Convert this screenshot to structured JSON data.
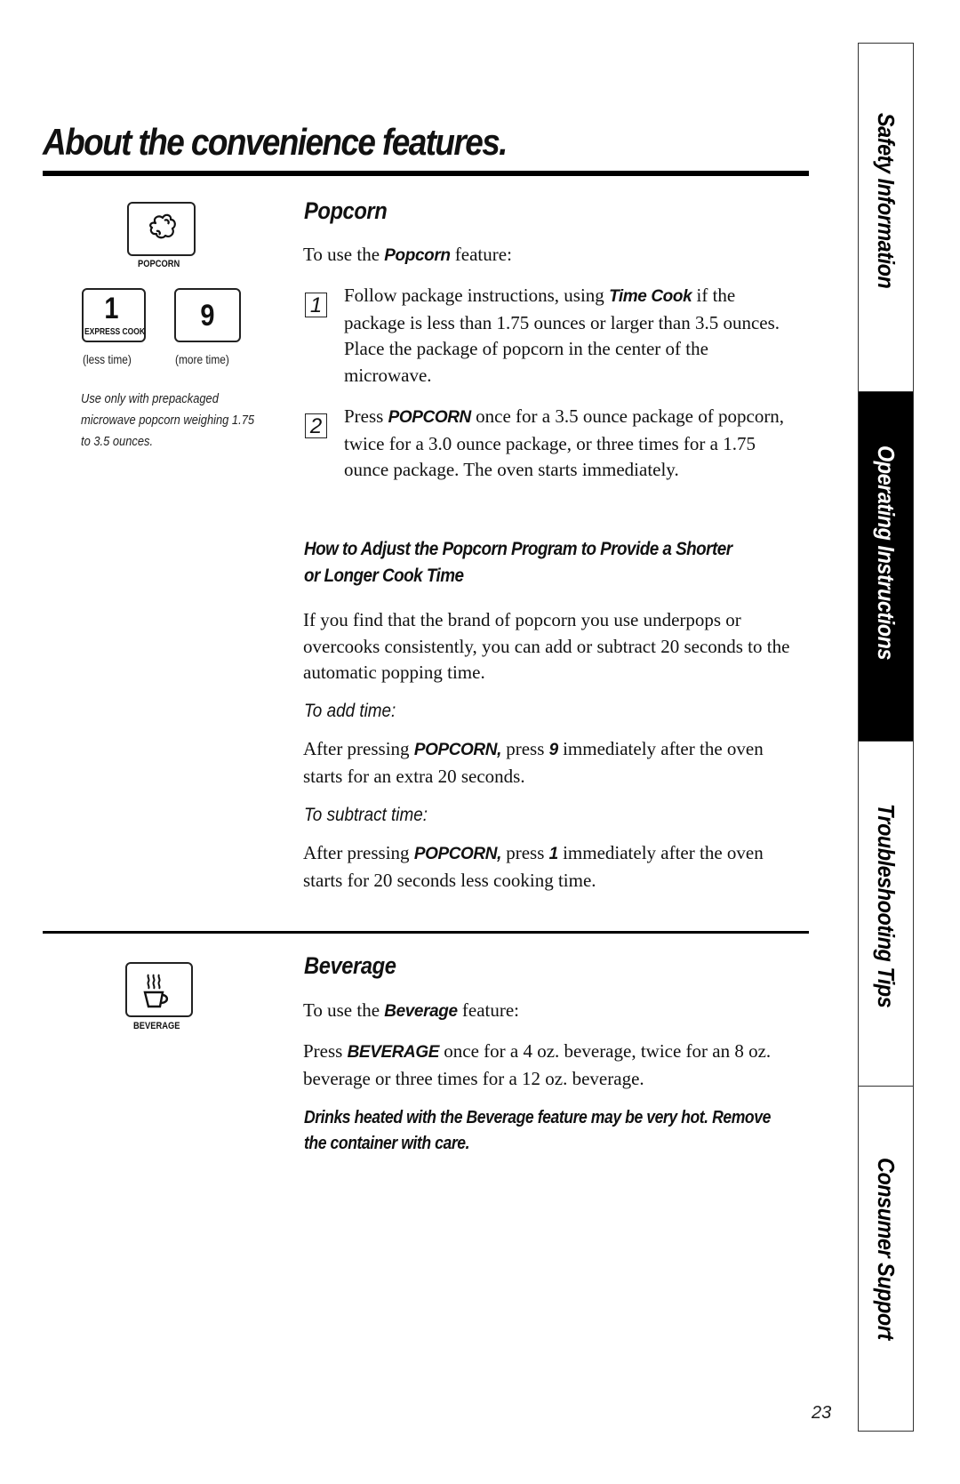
{
  "page": {
    "title": "About the convenience features.",
    "page_number": "23"
  },
  "side_tabs": [
    {
      "label": "Safety Information",
      "active": false
    },
    {
      "label": "Operating Instructions",
      "active": true
    },
    {
      "label": "Troubleshooting Tips",
      "active": false
    },
    {
      "label": "Consumer Support",
      "active": false
    }
  ],
  "popcorn": {
    "heading": "Popcorn",
    "icon": "popcorn-icon",
    "key_label": "POPCORN",
    "key_one": {
      "digit": "1",
      "label": "EXPRESS COOK",
      "caption": "(less time)"
    },
    "key_nine": {
      "digit": "9",
      "caption": "(more time)"
    },
    "note": "Use only with prepackaged microwave popcorn weighing 1.75 to 3.5 ounces.",
    "intro": {
      "before": "To use the ",
      "bold": "Popcorn",
      "after": " feature:"
    },
    "steps": [
      {
        "number": "1",
        "before": "Follow package instructions, using ",
        "bold": "Time Cook",
        "after": " if the package is less than 1.75 ounces or larger than 3.5 ounces. Place the package of popcorn in the center of the microwave."
      },
      {
        "number": "2",
        "before": "Press ",
        "bold": "POPCORN",
        "after": " once for a 3.5 ounce package of popcorn, twice for a 3.0 ounce package, or three times for a 1.75 ounce package. The oven starts immediately."
      }
    ],
    "adjust": {
      "heading": "How to Adjust the Popcorn Program to Provide a Shorter or Longer Cook Time",
      "body": "If you find that the brand of popcorn you use underpops or overcooks consistently, you can add or subtract 20 seconds to the automatic popping time.",
      "add": {
        "label": "To add time:",
        "before": "After pressing ",
        "bold1": "POPCORN,",
        "middle": " press ",
        "bold2": "9",
        "after": "  immediately after the oven starts for an extra 20 seconds."
      },
      "subtract": {
        "label": "To subtract time:",
        "before": "After pressing ",
        "bold1": "POPCORN,",
        "middle": " press ",
        "bold2": "1",
        "after": "  immediately after the oven starts for 20 seconds less cooking time."
      }
    }
  },
  "beverage": {
    "heading": "Beverage",
    "icon": "beverage-cup-icon",
    "key_label": "BEVERAGE",
    "intro": {
      "before": "To use the ",
      "bold": "Beverage",
      "after": " feature:"
    },
    "instructions": {
      "before": "Press ",
      "bold": "BEVERAGE",
      "after": " once for a 4 oz. beverage, twice for an 8 oz. beverage or three times for a 12 oz. beverage."
    },
    "warning": "Drinks heated with the Beverage feature may be very hot. Remove the container with care."
  }
}
